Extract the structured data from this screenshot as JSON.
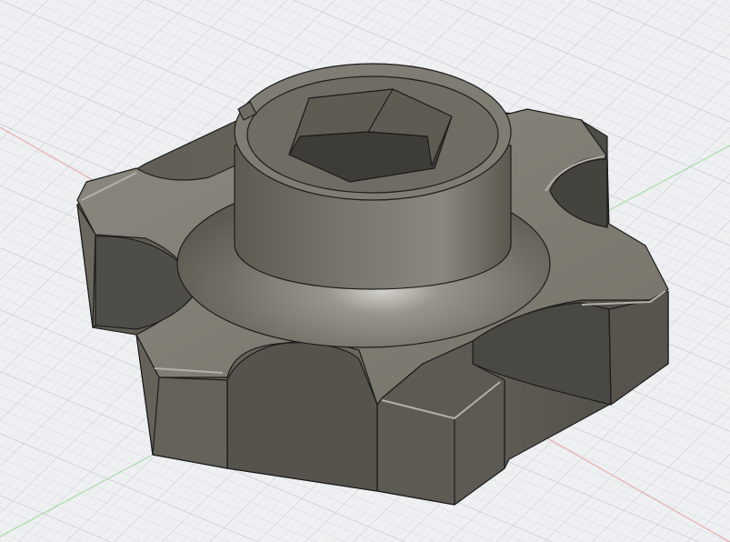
{
  "viewport": {
    "background": "#eef0f2",
    "grid_minor_color": "#d5d9dd",
    "grid_major_color": "#c3c8cd",
    "x_axis_color": "#e8a0a0",
    "y_axis_color": "#9fd89f"
  },
  "model": {
    "name": "knob",
    "feature_count": 6,
    "body_color": "#6f6c62",
    "top_face_color": "#86837a",
    "side_face_color": "#5a574f",
    "dark_face_color": "#4a4841",
    "edge_color": "#1d1d1d",
    "highlight_color": "#cfcfc8"
  }
}
